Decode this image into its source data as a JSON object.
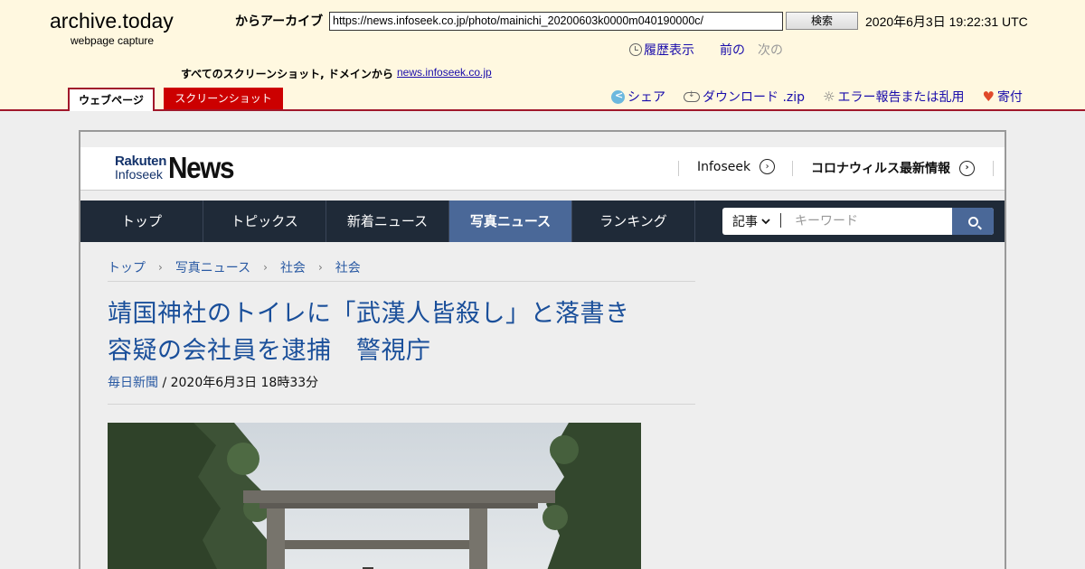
{
  "archive": {
    "logo": "archive.today",
    "subtitle": "webpage capture",
    "from_label": "からアーカイブ",
    "url": "https://news.infoseek.co.jp/photo/mainichi_20200603k0000m040190000c/",
    "search_button": "検索",
    "capture_date": "2020年6月3日 19:22:31 UTC",
    "history": "履歴表示",
    "prev": "前の",
    "next": "次の",
    "all_screenshots_label": "すべてのスクリーンショット, ドメインから",
    "domain": "news.infoseek.co.jp",
    "tab_webpage": "ウェブページ",
    "tab_screenshot": "スクリーンショット",
    "share": "シェア",
    "download": "ダウンロード .zip",
    "report": "エラー報告または乱用",
    "donate": "寄付"
  },
  "site": {
    "logo_rakuten": "Rakuten",
    "logo_infoseek": "Infoseek",
    "logo_news": "News",
    "link_infoseek": "Infoseek",
    "link_corona": "コロナウィルス最新情報",
    "nav": [
      "トップ",
      "トピックス",
      "新着ニュース",
      "写真ニュース",
      "ランキング"
    ],
    "active_nav": "写真ニュース",
    "search_category": "記事",
    "search_placeholder": "キーワード"
  },
  "article": {
    "breadcrumb": [
      "トップ",
      "写真ニュース",
      "社会",
      "社会"
    ],
    "headline_line1": "靖国神社のトイレに「武漢人皆殺し」と落書き",
    "headline_line2": "容疑の会社員を逮捕　警視庁",
    "source": "毎日新聞",
    "date": "/ 2020年6月3日 18時33分"
  },
  "colors": {
    "archive_bg": "#fff8e0",
    "archive_accent": "#a1182b",
    "nav_bg": "#1f2a38",
    "nav_active": "#4a6898",
    "headline": "#1a4f9a"
  }
}
